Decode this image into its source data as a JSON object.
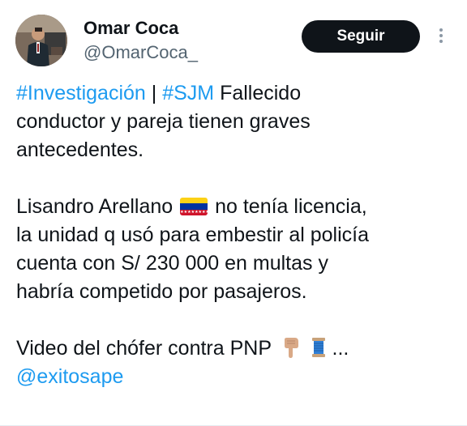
{
  "author": {
    "name": "Omar Coca",
    "handle": "@OmarCoca_"
  },
  "actions": {
    "follow_label": "Seguir"
  },
  "icons": {
    "more": "more-options-icon",
    "flag": "venezuela-flag-icon",
    "hand": "pointing-down-hand-icon",
    "thread": "thread-spool-icon"
  },
  "tweet": {
    "hashtag1": "#Investigación",
    "separator": " | ",
    "hashtag2": "#SJM",
    "line1_rest": " Fallecido",
    "line2": "conductor y pareja tienen graves",
    "line3": "antecedentes.",
    "line4_start": "Lisandro Arellano ",
    "line4_end": " no tenía licencia,",
    "line5": "la unidad q usó para embestir al policía",
    "line6": "cuenta con S/ 230 000 en multas y",
    "line7": "habría competido por pasajeros.",
    "line8": "Video del chófer contra PNP ",
    "ellipsis": "...",
    "mention": "@exitosape"
  },
  "colors": {
    "link": "#1d9bf0",
    "text": "#0f1419",
    "secondary": "#536471",
    "button_bg": "#0f1419"
  }
}
